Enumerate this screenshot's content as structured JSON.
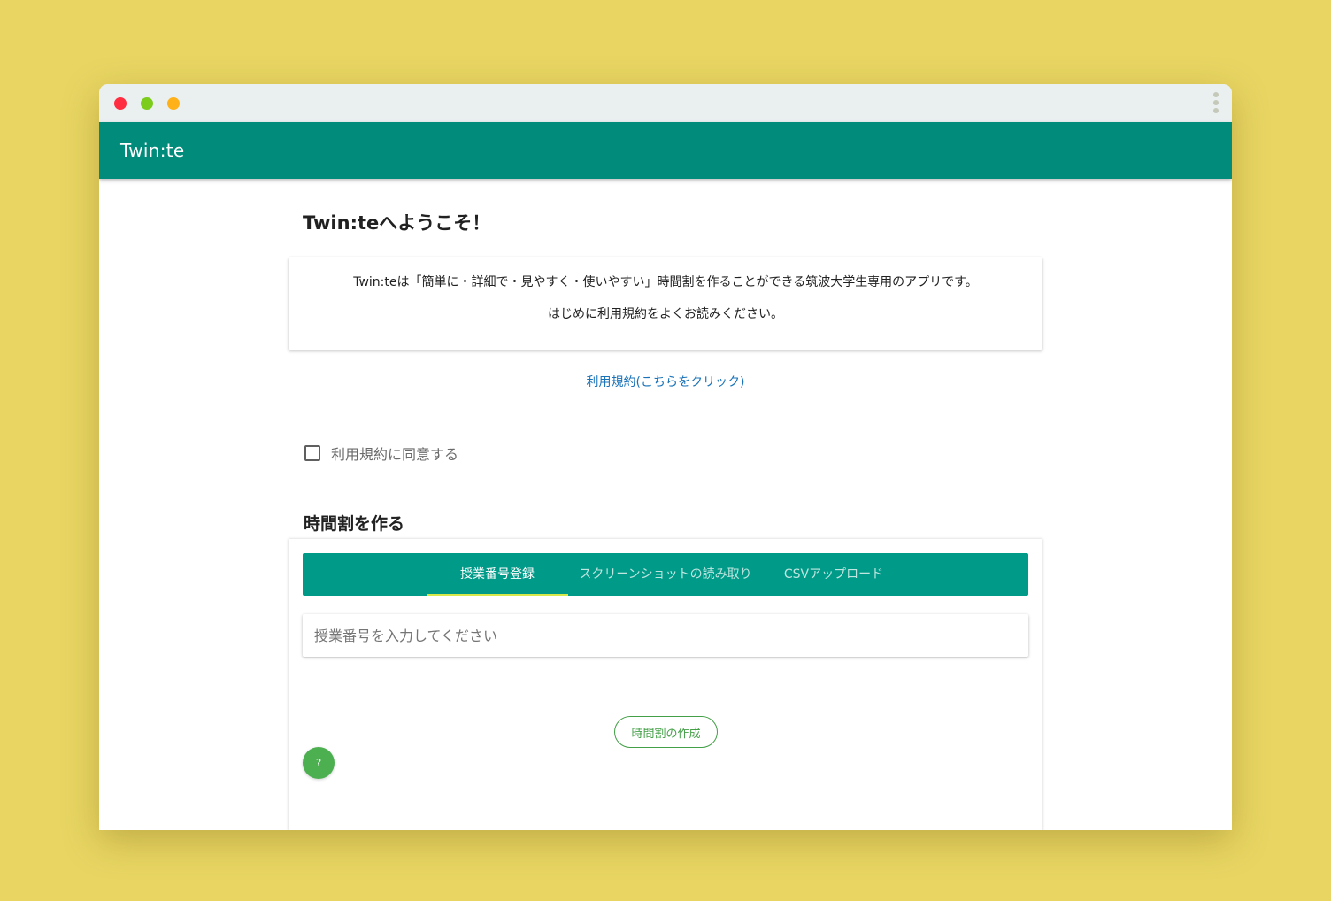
{
  "colors": {
    "background": "#e8d562",
    "primary": "#008b7a",
    "tabs": "#009a88",
    "tab_indicator": "#d7e84a",
    "link": "#1a73b8",
    "accent_green": "#43a047",
    "fab_green": "#4caf50",
    "dot_red": "#ff2d3f",
    "dot_green": "#7ccc1b",
    "dot_yellow": "#ffb11a"
  },
  "window": {
    "dots": [
      "close",
      "minimize",
      "maximize"
    ],
    "menu_icon": "more-vertical-icon"
  },
  "appbar": {
    "title": "Twin:te"
  },
  "welcome": {
    "heading": "Twin:teへようこそ！",
    "intro_line1": "Twin:teは「簡単に・詳細で・見やすく・使いやすい」時間割を作ることができる筑波大学生専用のアプリです。",
    "intro_line2": "はじめに利用規約をよくお読みください。",
    "terms_link": "利用規約(こちらをクリック)",
    "agree_label": "利用規約に同意する",
    "agree_checked": false
  },
  "create": {
    "heading": "時間割を作る",
    "tabs": [
      {
        "label": "授業番号登録",
        "active": true
      },
      {
        "label": "スクリーンショットの読み取り",
        "active": false
      },
      {
        "label": "CSVアップロード",
        "active": false
      }
    ],
    "input_placeholder": "授業番号を入力してください",
    "input_value": "",
    "button_label": "時間割の作成"
  },
  "help": {
    "label": "?"
  }
}
